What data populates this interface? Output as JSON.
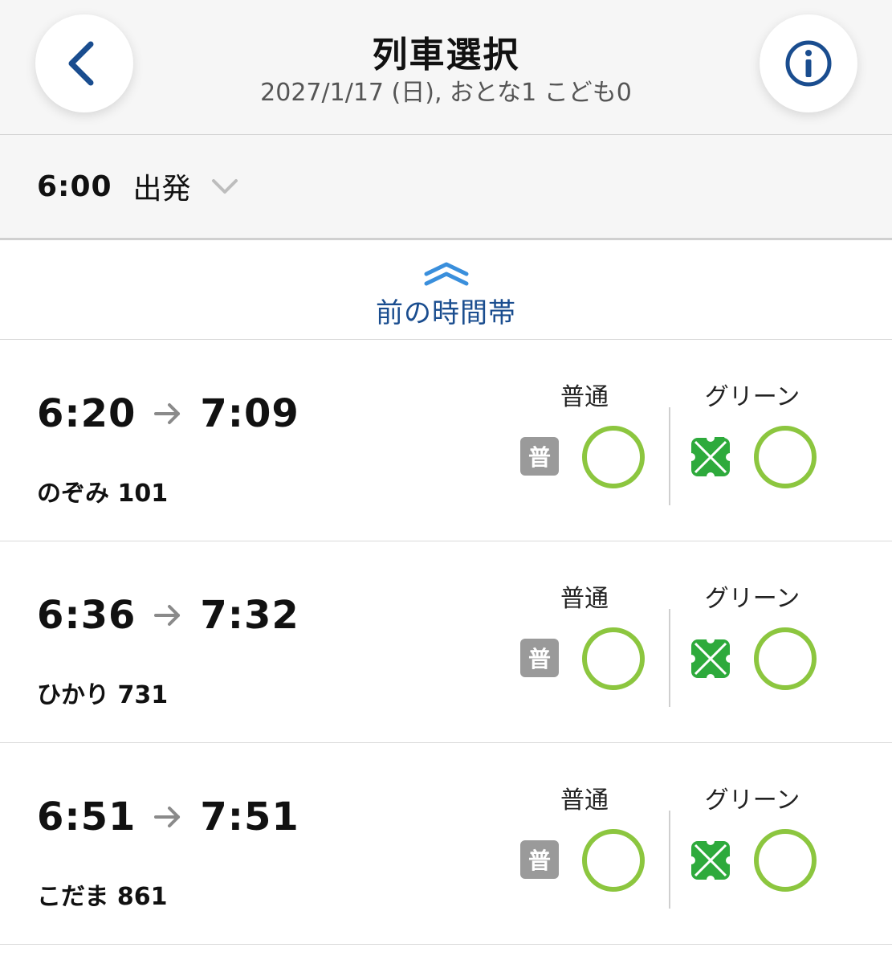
{
  "header": {
    "title": "列車選択",
    "subtitle": "2027/1/17 (日), おとな1 こども0"
  },
  "departure": {
    "time": "6:00",
    "label": "出発"
  },
  "previous_band": {
    "label": "前の時間帯"
  },
  "columns": {
    "ordinary": "普通",
    "green": "グリーン",
    "ordinary_badge": "普"
  },
  "colors": {
    "accent_blue": "#1a4d8f",
    "chevron_blue": "#3a8fdc",
    "available_green": "#8cc63f",
    "green_car": "#2eaa3c",
    "ordinary_badge": "#9a9a9a"
  },
  "icons": {
    "back": "chevron-left-icon",
    "info": "info-icon",
    "dropdown": "chevron-down-icon",
    "previous": "double-chevron-up-icon",
    "arrow": "arrow-right-icon",
    "green_car": "clover-icon",
    "available": "circle-icon"
  },
  "trains": [
    {
      "depart": "6:20",
      "arrive": "7:09",
      "name": "のぞみ 101"
    },
    {
      "depart": "6:36",
      "arrive": "7:32",
      "name": "ひかり 731"
    },
    {
      "depart": "6:51",
      "arrive": "7:51",
      "name": "こだま 861"
    }
  ]
}
